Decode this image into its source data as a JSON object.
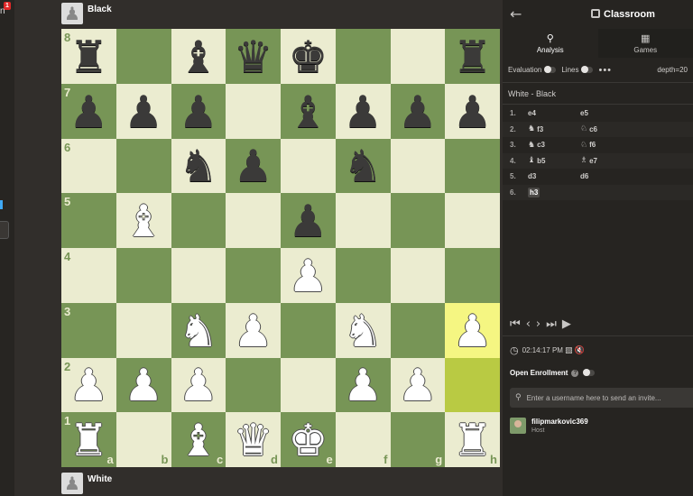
{
  "left_strip": {
    "badge_count": "1",
    "label_fragment": "n"
  },
  "players": {
    "top": "Black",
    "bottom": "White"
  },
  "board": {
    "ranks": [
      "8",
      "7",
      "6",
      "5",
      "4",
      "3",
      "2",
      "1"
    ],
    "files": [
      "a",
      "b",
      "c",
      "d",
      "e",
      "f",
      "g",
      "h"
    ],
    "highlighted_squares": [
      "h3",
      "h2"
    ],
    "position": [
      [
        "r",
        "",
        "b",
        "q",
        "k",
        "",
        "",
        "r"
      ],
      [
        "p",
        "p",
        "p",
        "",
        "b",
        "p",
        "p",
        "p"
      ],
      [
        "",
        "",
        "n",
        "p",
        "",
        "n",
        "",
        ""
      ],
      [
        "",
        "B",
        "",
        "",
        "p",
        "",
        "",
        ""
      ],
      [
        "",
        "",
        "",
        "",
        "P",
        "",
        "",
        ""
      ],
      [
        "",
        "",
        "N",
        "P",
        "",
        "N",
        "",
        "P"
      ],
      [
        "P",
        "P",
        "P",
        "",
        "",
        "P",
        "P",
        ""
      ],
      [
        "R",
        "",
        "B",
        "Q",
        "K",
        "",
        "",
        "R"
      ]
    ]
  },
  "panel": {
    "title": "Classroom",
    "tabs": [
      {
        "label": "Analysis",
        "icon": "magnifier-icon",
        "active": true
      },
      {
        "label": "Games",
        "icon": "clapper-icon",
        "active": false
      }
    ],
    "options": {
      "evaluation": "Evaluation",
      "lines": "Lines",
      "depth": "depth=20"
    },
    "game_title": "White - Black",
    "moves": [
      {
        "num": "1.",
        "white": "e4",
        "white_piece": "",
        "black": "e5",
        "black_piece": ""
      },
      {
        "num": "2.",
        "white": "f3",
        "white_piece": "♞",
        "black": "c6",
        "black_piece": "♘"
      },
      {
        "num": "3.",
        "white": "c3",
        "white_piece": "♞",
        "black": "f6",
        "black_piece": "♘"
      },
      {
        "num": "4.",
        "white": "b5",
        "white_piece": "♝",
        "black": "e7",
        "black_piece": "♗"
      },
      {
        "num": "5.",
        "white": "d3",
        "white_piece": "",
        "black": "d6",
        "black_piece": ""
      },
      {
        "num": "6.",
        "white": "h3",
        "white_piece": "",
        "black": "",
        "black_piece": ""
      }
    ],
    "timer": "02:14:17 PM",
    "open_enrollment": "Open Enrollment",
    "search_placeholder": "Enter a username here to send an invite...",
    "host": {
      "name": "filipmarkovic369",
      "role": "Host"
    }
  },
  "colors": {
    "light_square": "#ebecd0",
    "dark_square": "#779556",
    "highlight_light": "#f5f682",
    "highlight_dark": "#b9ca43"
  }
}
